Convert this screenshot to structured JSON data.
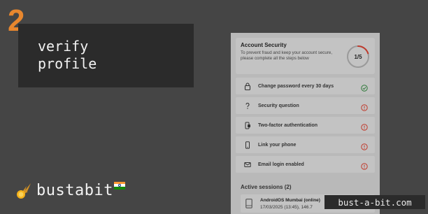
{
  "slide": {
    "step_number": "2",
    "title_line1": "verify",
    "title_line2": "profile",
    "accent_color": "#e8872e"
  },
  "brand": {
    "name": "bustabit",
    "logo_icon": "flaming-ball-icon",
    "flag_icon": "india-flag-icon"
  },
  "watermark": "bust-a-bit.com",
  "account_security": {
    "title": "Account Security",
    "description": "To prevent fraud and keep your account secure, please complete all the steps below",
    "progress_text": "1/5",
    "progress_fraction": 0.2,
    "steps": [
      {
        "icon": "lock-icon",
        "label": "Change password every 30 days",
        "status": "complete"
      },
      {
        "icon": "question-icon",
        "label": "Security question",
        "status": "pending"
      },
      {
        "icon": "two-factor-icon",
        "label": "Two-factor authentication",
        "status": "pending"
      },
      {
        "icon": "phone-icon",
        "label": "Link your phone",
        "status": "pending"
      },
      {
        "icon": "mail-icon",
        "label": "Email login enabled",
        "status": "pending"
      }
    ],
    "status_colors": {
      "complete": "#2f7a3a",
      "pending": "#c0392b"
    }
  },
  "active_sessions": {
    "title": "Active sessions (2)",
    "sessions": [
      {
        "icon": "device-icon",
        "device": "AndroidOS Mumbai (online)",
        "time": "17/03/2025 (13:45), 146.7"
      }
    ]
  }
}
